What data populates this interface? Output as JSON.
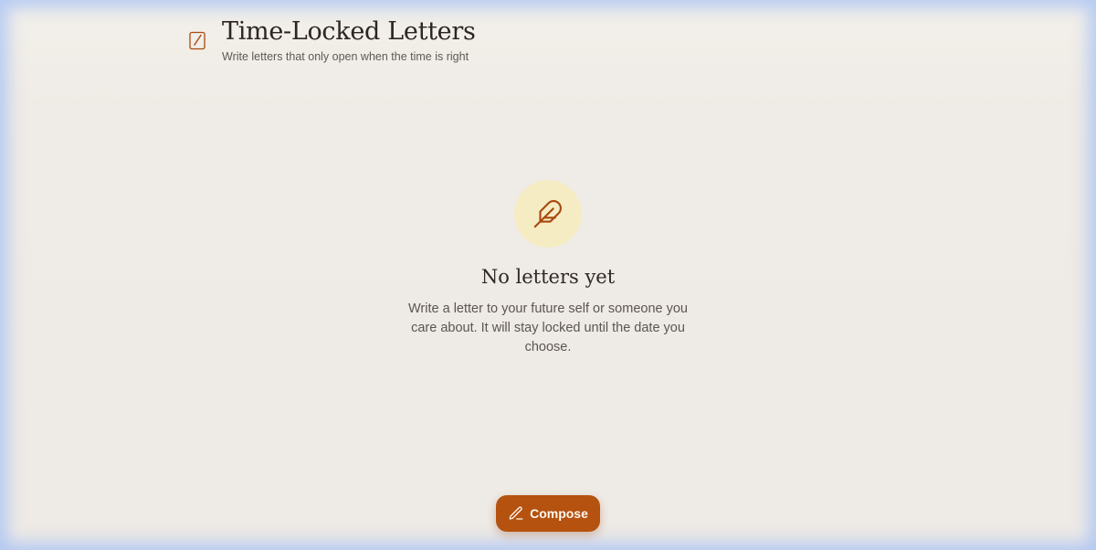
{
  "header": {
    "title": "Time-Locked Letters",
    "subtitle": "Write letters that only open when the time is right",
    "logo_icon": "letter-pencil-icon"
  },
  "empty_state": {
    "icon": "feather-icon",
    "title": "No letters yet",
    "message": "Write a letter to your future self or someone you care about. It will stay locked until the date you choose."
  },
  "compose_button": {
    "label": "Compose",
    "icon": "pencil-icon"
  },
  "colors": {
    "accent": "#b5520f",
    "background": "#eeeae5",
    "icon_circle": "#f6ecc4",
    "icon_stroke": "#a8480f"
  }
}
